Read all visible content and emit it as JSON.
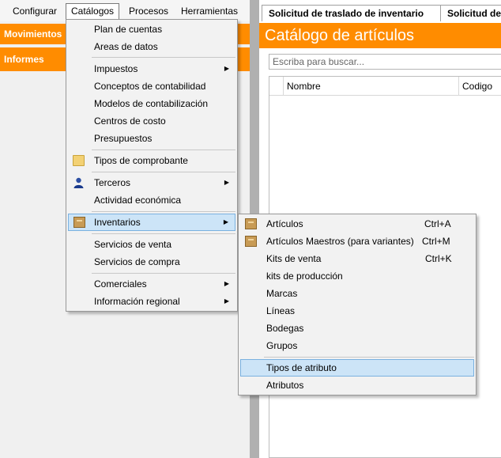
{
  "menubar": {
    "items": [
      {
        "label": "Configurar"
      },
      {
        "label": "Catálogos"
      },
      {
        "label": "Procesos"
      },
      {
        "label": "Herramientas"
      }
    ]
  },
  "nav": {
    "items": [
      {
        "label": "Movimientos"
      },
      {
        "label": "Informes"
      }
    ]
  },
  "catalogos_menu": {
    "items": [
      {
        "label": "Plan de cuentas"
      },
      {
        "label": "Areas de datos"
      },
      {
        "label": "Impuestos",
        "submenu": true
      },
      {
        "label": "Conceptos de contabilidad"
      },
      {
        "label": "Modelos de contabilización"
      },
      {
        "label": "Centros de costo"
      },
      {
        "label": "Presupuestos"
      },
      {
        "label": "Tipos de comprobante",
        "icon": "folder-icon"
      },
      {
        "label": "Terceros",
        "icon": "person-icon",
        "submenu": true
      },
      {
        "label": "Actividad económica"
      },
      {
        "label": "Inventarios",
        "icon": "box-icon",
        "submenu": true
      },
      {
        "label": "Servicios de venta"
      },
      {
        "label": "Servicios de compra"
      },
      {
        "label": "Comerciales",
        "submenu": true
      },
      {
        "label": "Información regional",
        "submenu": true
      }
    ]
  },
  "inventarios_menu": {
    "items": [
      {
        "label": "Artículos",
        "shortcut": "Ctrl+A",
        "icon": "box-icon"
      },
      {
        "label": "Artículos Maestros (para variantes)",
        "shortcut": "Ctrl+M",
        "icon": "box-icon"
      },
      {
        "label": "Kits de venta",
        "shortcut": "Ctrl+K"
      },
      {
        "label": "kits de producción"
      },
      {
        "label": "Marcas"
      },
      {
        "label": "Líneas"
      },
      {
        "label": "Bodegas"
      },
      {
        "label": "Grupos"
      },
      {
        "label": "Tipos de atributo"
      },
      {
        "label": "Atributos"
      }
    ]
  },
  "right_panel": {
    "tabs": [
      {
        "label": "Solicitud de traslado de inventario"
      },
      {
        "label": "Solicitud de tra"
      }
    ],
    "title": "Catálogo de artículos",
    "search_placeholder": "Escriba para buscar...",
    "columns": [
      {
        "label": "Nombre"
      },
      {
        "label": "Codigo"
      }
    ]
  },
  "colors": {
    "accent": "#ff8c00",
    "highlight": "#cce4f7"
  }
}
